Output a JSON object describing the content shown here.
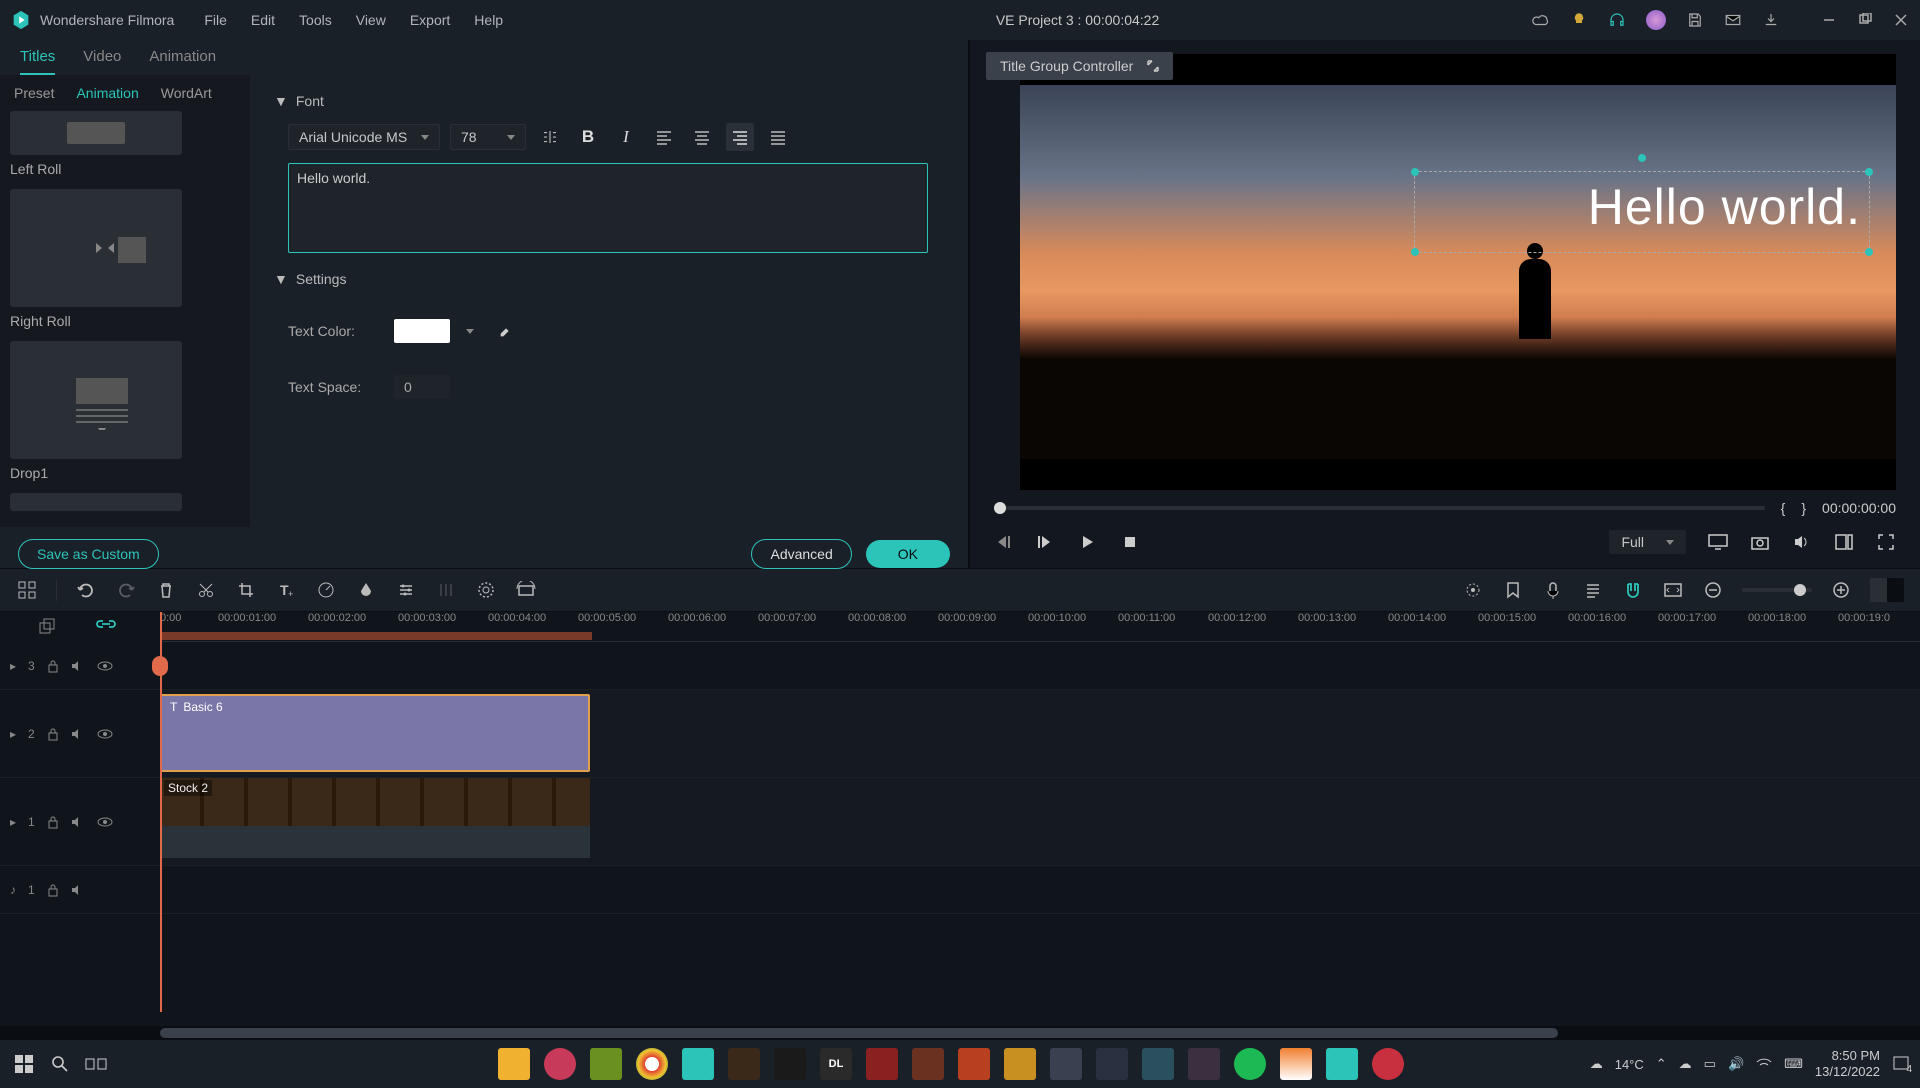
{
  "titlebar": {
    "app_name": "Wondershare Filmora",
    "menu": [
      "File",
      "Edit",
      "Tools",
      "View",
      "Export",
      "Help"
    ],
    "project": "VE Project 3 : 00:00:04:22"
  },
  "tabs": {
    "items": [
      "Titles",
      "Video",
      "Animation"
    ],
    "active": 0
  },
  "subtabs": {
    "items": [
      "Preset",
      "Animation",
      "WordArt"
    ],
    "active": 1
  },
  "presets": [
    {
      "label": "Left Roll"
    },
    {
      "label": "Right Roll"
    },
    {
      "label": "Drop1"
    }
  ],
  "font_section": {
    "title": "Font",
    "family": "Arial Unicode MS",
    "size": "78",
    "text_value": "Hello world."
  },
  "settings_section": {
    "title": "Settings",
    "text_color_label": "Text Color:",
    "text_space_label": "Text Space:",
    "text_space_value": "0"
  },
  "buttons": {
    "save_custom": "Save as Custom",
    "advanced": "Advanced",
    "ok": "OK"
  },
  "preview": {
    "controller_label": "Title Group Controller",
    "overlay_text": "Hello world.",
    "mark_in": "{",
    "mark_out": "}",
    "timecode": "00:00:00:00",
    "quality": "Full"
  },
  "ruler_ticks": [
    "0:00",
    "00:00:01:00",
    "00:00:02:00",
    "00:00:03:00",
    "00:00:04:00",
    "00:00:05:00",
    "00:00:06:00",
    "00:00:07:00",
    "00:00:08:00",
    "00:00:09:00",
    "00:00:10:00",
    "00:00:11:00",
    "00:00:12:00",
    "00:00:13:00",
    "00:00:14:00",
    "00:00:15:00",
    "00:00:16:00",
    "00:00:17:00",
    "00:00:18:00",
    "00:00:19:0"
  ],
  "tracks": {
    "t3": "3",
    "t2": "2",
    "t1": "1",
    "a1": "1",
    "title_clip": "Basic 6",
    "video_clip": "Stock 2"
  },
  "taskbar": {
    "weather": "14°C",
    "time": "8:50 PM",
    "date": "13/12/2022",
    "notif": "4"
  }
}
